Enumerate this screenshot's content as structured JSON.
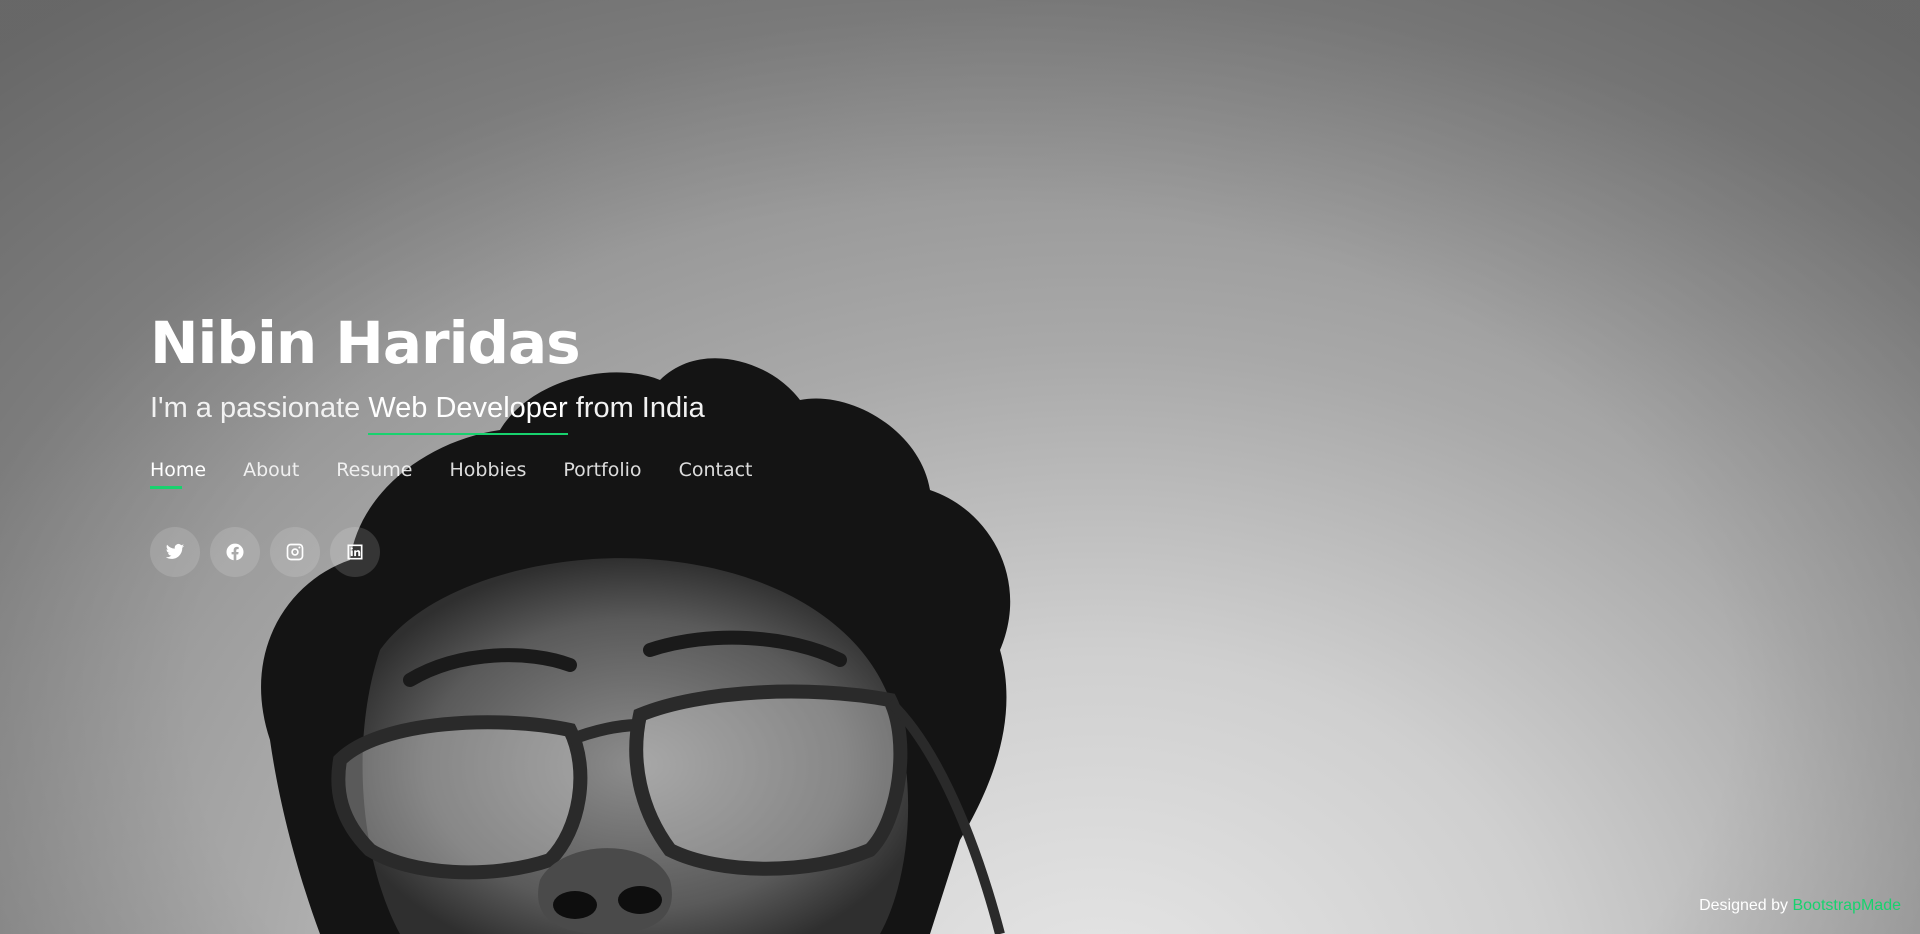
{
  "header": {
    "name": "Nibin Haridas",
    "tagline_prefix": "I'm a passionate",
    "tagline_typed": "Web Developer",
    "tagline_suffix": "from India"
  },
  "nav": {
    "items": [
      {
        "label": "Home",
        "active": true
      },
      {
        "label": "About",
        "active": false
      },
      {
        "label": "Resume",
        "active": false
      },
      {
        "label": "Hobbies",
        "active": false
      },
      {
        "label": "Portfolio",
        "active": false
      },
      {
        "label": "Contact",
        "active": false
      }
    ]
  },
  "social": {
    "links": [
      {
        "icon": "twitter-icon"
      },
      {
        "icon": "facebook-icon"
      },
      {
        "icon": "instagram-icon"
      },
      {
        "icon": "linkedin-icon"
      }
    ]
  },
  "credits": {
    "prefix": "Designed by",
    "link_text": "BootstrapMade"
  },
  "colors": {
    "accent": "#18d26e",
    "text": "#ffffff"
  }
}
